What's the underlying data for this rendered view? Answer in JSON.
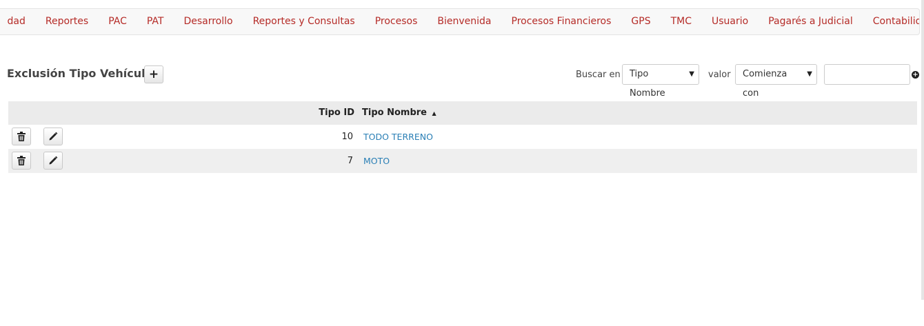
{
  "nav": {
    "items": [
      "dad",
      "Reportes",
      "PAC",
      "PAT",
      "Desarrollo",
      "Reportes y Consultas",
      "Procesos",
      "Bienvenida",
      "Procesos Financieros",
      "GPS",
      "TMC",
      "Usuario",
      "Pagarés a Judicial",
      "Contabilidad"
    ]
  },
  "page": {
    "title": "Exclusión Tipo Vehículo",
    "add_label": "+"
  },
  "search": {
    "buscar_label": "Buscar en",
    "field_selected": "Tipo Nombre",
    "valor_label": "valor",
    "mode_selected": "Comienza con",
    "input_value": "",
    "go_symbol": "+"
  },
  "table": {
    "headers": {
      "id": "Tipo ID",
      "name": "Tipo Nombre",
      "sort_indicator": "▲"
    },
    "rows": [
      {
        "id": "10",
        "name": "TODO TERRENO"
      },
      {
        "id": "7",
        "name": "MOTO"
      }
    ]
  },
  "colors": {
    "nav_text": "#b52b27",
    "link": "#2a7fb5"
  }
}
